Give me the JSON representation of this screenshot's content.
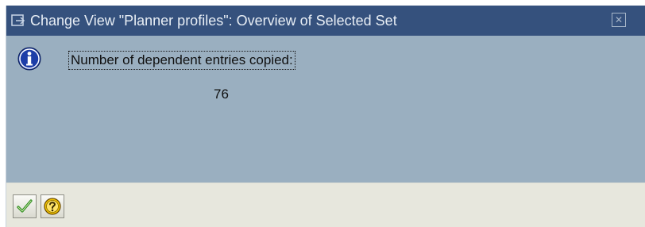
{
  "dialog": {
    "title": "Change View \"Planner profiles\": Overview of Selected Set",
    "close_icon": "close-icon",
    "title_icon": "window-icon"
  },
  "message": {
    "icon": "info-icon",
    "text": "Number of dependent entries copied:",
    "value": "76"
  },
  "toolbar": {
    "buttons": [
      {
        "icon": "checkmark-icon"
      },
      {
        "icon": "help-icon"
      }
    ]
  },
  "colors": {
    "titlebar": "#35517d",
    "content": "#9aafc0",
    "toolbar": "#e7e7dd",
    "info_blue": "#1d3ea8",
    "check_green": "#2e8b1f",
    "help_yellow": "#f2c400"
  }
}
